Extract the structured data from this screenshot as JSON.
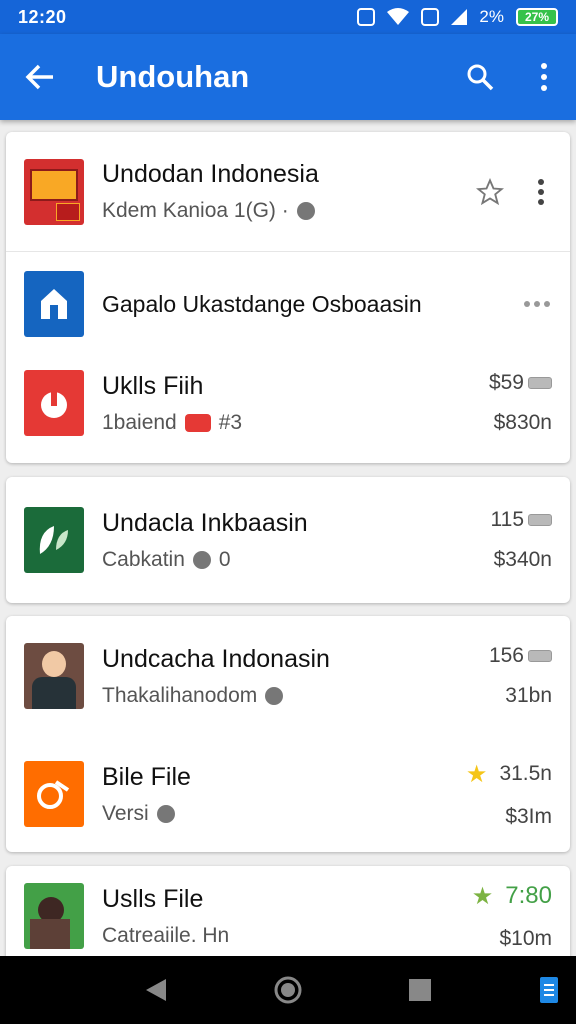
{
  "status": {
    "time": "12:20",
    "battery_text": "27%",
    "signal_text": "2%"
  },
  "app_bar": {
    "title": "Undouhan"
  },
  "rows": [
    {
      "title": "Undodan Indonesia",
      "subtitle": "Kdem Kanioa 1(G) ·",
      "right_top": "",
      "right_bottom": ""
    },
    {
      "title": "Gapalo Ukastdange Osboaasin",
      "subtitle": "",
      "right_top": "",
      "right_bottom": ""
    },
    {
      "title": "Uklls Fiih",
      "subtitle": "1baiend",
      "subtitle_extra": "#3",
      "right_top": "$59",
      "right_bottom": "$830n"
    },
    {
      "title": "Undacla Inkbaasin",
      "subtitle": "Cabkatin",
      "subtitle_extra": "0",
      "right_top": "115",
      "right_bottom": "$340n"
    },
    {
      "title": "Undcacha Indonasin",
      "subtitle": "Thakalihanodom",
      "right_top": "156",
      "right_bottom": "31bn"
    },
    {
      "title": "Bile File",
      "subtitle": "Versi",
      "right_top": "31.5n",
      "right_bottom": "$3Im"
    },
    {
      "title": "Uslls File",
      "subtitle": "Catreaiile. Hn",
      "right_top": "7:80",
      "right_bottom": "$10m"
    }
  ],
  "colors": {
    "app_bar": "#1a6ee0",
    "status_bar": "#1565d8",
    "star_yellow": "#f5c518",
    "star_green": "#7cb342"
  },
  "icons": [
    "back-arrow-icon",
    "search-icon",
    "more-vert-icon",
    "star-outline-icon",
    "star-filled-icon"
  ]
}
